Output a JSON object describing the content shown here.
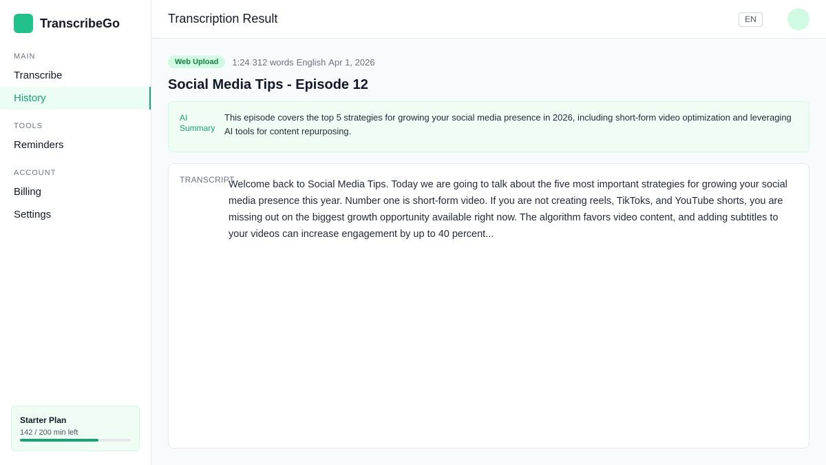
{
  "brand": {
    "name": "TranscribeGo"
  },
  "sidebar": {
    "sections": [
      {
        "label": "MAIN",
        "items": [
          {
            "label": "Transcribe",
            "active": false
          },
          {
            "label": "History",
            "active": true
          }
        ]
      },
      {
        "label": "TOOLS",
        "items": [
          {
            "label": "Reminders",
            "active": false
          }
        ]
      },
      {
        "label": "ACCOUNT",
        "items": [
          {
            "label": "Billing",
            "active": false
          },
          {
            "label": "Settings",
            "active": false
          }
        ]
      }
    ],
    "plan": {
      "name": "Starter Plan",
      "usage": "142 / 200 min left",
      "fraction_used": 0.71
    }
  },
  "header": {
    "title": "Transcription Result",
    "language": "EN"
  },
  "doc": {
    "source": "Web Upload",
    "duration": "1:24",
    "words": "312 words",
    "language": "English",
    "date": "Apr 1, 2026",
    "title": "Social Media Tips - Episode 12"
  },
  "summary": {
    "label": "AI Summary",
    "text": "This episode covers the top 5 strategies for growing your social media presence in 2026, including short-form video optimization and leveraging AI tools for content repurposing."
  },
  "transcript": {
    "label": "TRANSCRIPT",
    "text": "Welcome back to Social Media Tips. Today we are going to talk about the five most important strategies for growing your social media presence this year. Number one is short-form video. If you are not creating reels, TikToks, and YouTube shorts, you are missing out on the biggest growth opportunity available right now. The algorithm favors video content, and adding subtitles to your videos can increase engagement by up to 40 percent..."
  },
  "colors": {
    "accent": "#16a371",
    "brand": "#22c08a",
    "summary_bg": "#f0fdf4"
  }
}
